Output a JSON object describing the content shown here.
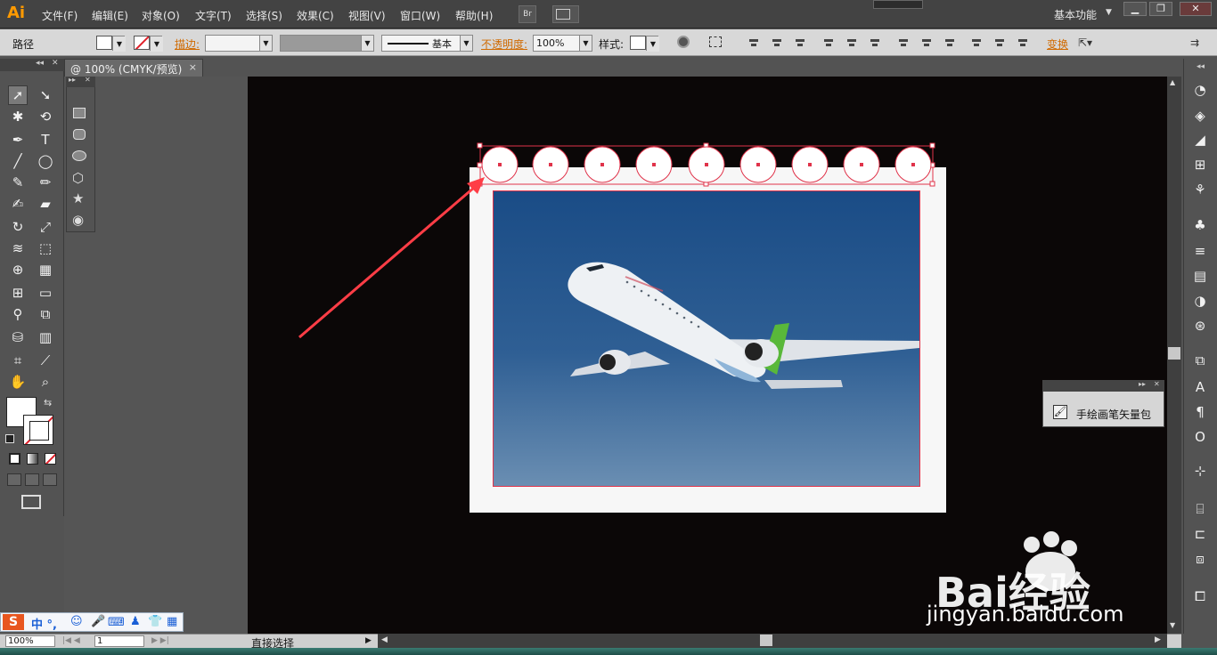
{
  "app": {
    "logo": "Ai",
    "workspace": "基本功能"
  },
  "menu": [
    "文件(F)",
    "编辑(E)",
    "对象(O)",
    "文字(T)",
    "选择(S)",
    "效果(C)",
    "视图(V)",
    "窗口(W)",
    "帮助(H)"
  ],
  "bridge_button": "Br",
  "control": {
    "object_type": "路径",
    "stroke_label": "描边:",
    "stroke_profile": "基本",
    "opacity_label": "不透明度:",
    "opacity_value": "100%",
    "style_label": "样式:",
    "transform_label": "变换"
  },
  "document": {
    "tab_title": "@ 100% (CMYK/预览)",
    "close": "×"
  },
  "status": {
    "zoom": "100%",
    "artboard": "1",
    "tool_name": "直接选择"
  },
  "panels": {
    "brush_library": "手绘画笔矢量包"
  },
  "watermark": {
    "brand": "Bai经验",
    "url": "jingyan.baidu.com"
  },
  "icons": {
    "toolbar": [
      "selection-tool",
      "direct-selection-tool",
      "magic-wand-tool",
      "lasso-tool",
      "pen-tool",
      "type-tool",
      "line-tool",
      "ellipse-tool",
      "paintbrush-tool",
      "pencil-tool",
      "blob-brush-tool",
      "eraser-tool",
      "rotate-tool",
      "scale-tool",
      "width-tool",
      "free-transform-tool",
      "shape-builder-tool",
      "perspective-grid-tool",
      "mesh-tool",
      "gradient-tool",
      "eyedropper-tool",
      "blend-tool",
      "live-paint-bucket-tool",
      "column-graph-tool",
      "artboard-tool",
      "slice-tool",
      "hand-tool",
      "zoom-tool"
    ],
    "shapes": [
      "rectangle-icon",
      "rounded-rectangle-icon",
      "ellipse-icon",
      "polygon-icon",
      "star-icon",
      "flare-icon"
    ]
  },
  "colors": {
    "accent": "#d06a00",
    "selection": "#e0334a",
    "canvas": "#0b0707"
  }
}
